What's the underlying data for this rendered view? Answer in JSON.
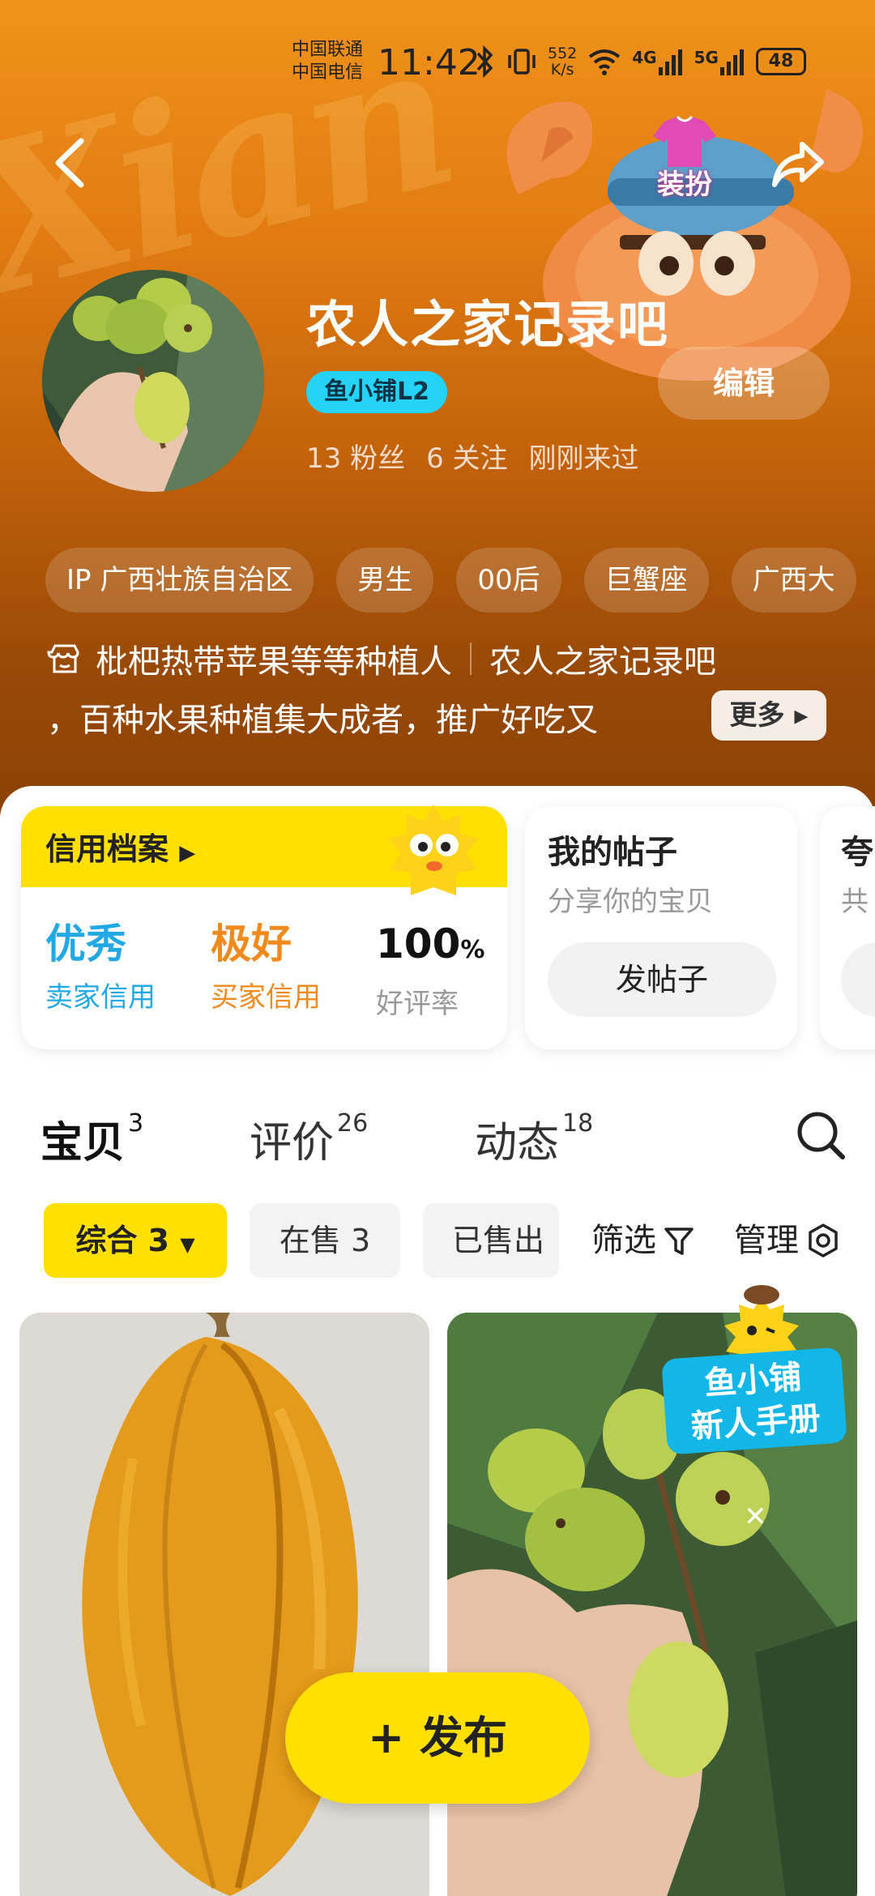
{
  "status_bar": {
    "carrier_1": "中国联通",
    "carrier_2": "中国电信",
    "time": "11:42",
    "net_speed_value": "552",
    "net_speed_unit": "K/s",
    "signal_1": "4G",
    "signal_2": "5G",
    "battery": "48"
  },
  "header": {
    "dress_label": "装扮",
    "username": "农人之家记录吧",
    "level_badge": "鱼小铺L2",
    "edit_label": "编辑",
    "stats": {
      "fans": "13 粉丝",
      "following": "6 关注",
      "last_seen": "刚刚来过"
    },
    "tags": [
      "IP 广西壮族自治区",
      "男生",
      "00后",
      "巨蟹座",
      "广西大"
    ],
    "bio_line1_a": "枇杷热带苹果等等种植人",
    "bio_line1_b": "农人之家记录吧",
    "bio_line2": "，百种水果种植集大成者，推广好吃又",
    "more_label": "更多"
  },
  "credit": {
    "title": "信用档案",
    "items": [
      {
        "value": "优秀",
        "label": "卖家信用",
        "color": "#23a8e6"
      },
      {
        "value": "极好",
        "label": "买家信用",
        "color": "#f08a1c"
      },
      {
        "value": "100",
        "unit": "%",
        "label": "好评率",
        "color": "#111111"
      }
    ]
  },
  "post_card": {
    "title": "我的帖子",
    "subtitle": "分享你的宝贝",
    "button": "发帖子"
  },
  "third_card": {
    "title": "夸",
    "subtitle": "共"
  },
  "tabs": [
    {
      "label": "宝贝",
      "count": "3"
    },
    {
      "label": "评价",
      "count": "26"
    },
    {
      "label": "动态",
      "count": "18"
    }
  ],
  "filters": {
    "all": "综合 3",
    "on_sale": "在售 3",
    "sold": "已售出",
    "screen": "筛选",
    "manage": "管理"
  },
  "promo": {
    "line1": "鱼小铺",
    "line2": "新人手册"
  },
  "fab": {
    "label": "+ 发布"
  },
  "colors": {
    "brand_yellow": "#ffe000",
    "header_orange": "#e27c12",
    "accent_cyan": "#24d3f5"
  }
}
